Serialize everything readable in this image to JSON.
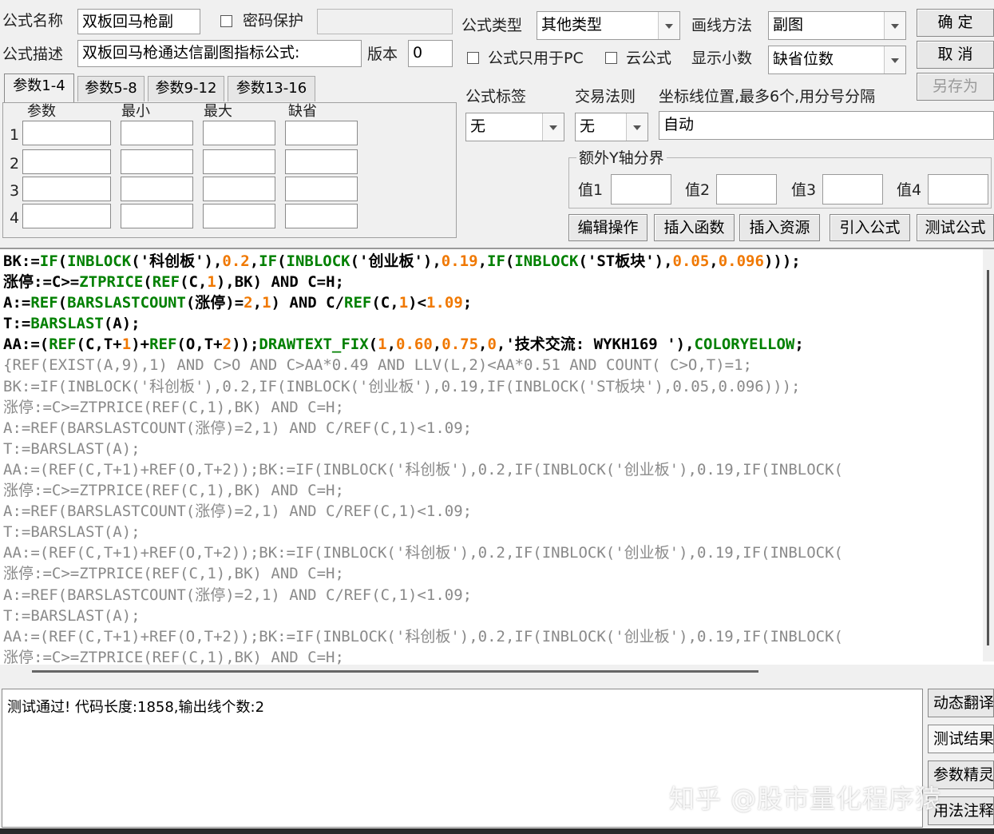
{
  "header": {
    "name_label": "公式名称",
    "name_value": "双板回马枪副",
    "password_label": "密码保护",
    "desc_label": "公式描述",
    "desc_value": "双板回马枪通达信副图指标公式:",
    "version_label": "版本",
    "version_value": "0",
    "type_label": "公式类型",
    "type_value": "其他类型",
    "draw_label": "画线方法",
    "draw_value": "副图",
    "pc_only_label": "公式只用于PC",
    "cloud_label": "云公式",
    "decimals_label": "显示小数",
    "decimals_value": "缺省位数"
  },
  "buttons": {
    "ok": "确  定",
    "cancel": "取  消",
    "save_as": "另存为",
    "edit_ops": "编辑操作",
    "insert_func": "插入函数",
    "insert_res": "插入资源",
    "import_formula": "引入公式",
    "test_formula": "测试公式"
  },
  "tabs": [
    "参数1-4",
    "参数5-8",
    "参数9-12",
    "参数13-16"
  ],
  "params": {
    "headers": [
      "参数",
      "最小",
      "最大",
      "缺省"
    ],
    "rows": [
      "1",
      "2",
      "3",
      "4"
    ]
  },
  "options": {
    "tag_label": "公式标签",
    "tag_value": "无",
    "rule_label": "交易法则",
    "rule_value": "无",
    "axis_label": "坐标线位置,最多6个,用分号分隔",
    "axis_value": "自动",
    "yaxis_group": "额外Y轴分界",
    "y1": "值1",
    "y2": "值2",
    "y3": "值3",
    "y4": "值4"
  },
  "code_lines": [
    {
      "segs": [
        [
          "BK:=",
          "#000"
        ],
        [
          "IF",
          "#008000"
        ],
        [
          "(",
          "#000"
        ],
        [
          "INBLOCK",
          "#008000"
        ],
        [
          "('科创板'),",
          "#000"
        ],
        [
          "0.2",
          "#f07800"
        ],
        [
          ",",
          "#000"
        ],
        [
          "IF",
          "#008000"
        ],
        [
          "(",
          "#000"
        ],
        [
          "INBLOCK",
          "#008000"
        ],
        [
          "('创业板'),",
          "#000"
        ],
        [
          "0.19",
          "#f07800"
        ],
        [
          ",",
          "#000"
        ],
        [
          "IF",
          "#008000"
        ],
        [
          "(",
          "#000"
        ],
        [
          "INBLOCK",
          "#008000"
        ],
        [
          "('ST板块'),",
          "#000"
        ],
        [
          "0.05",
          "#f07800"
        ],
        [
          ",",
          "#000"
        ],
        [
          "0.096",
          "#f07800"
        ],
        [
          ")));",
          "#000"
        ]
      ]
    },
    {
      "segs": [
        [
          "涨停:=C>=",
          "#000"
        ],
        [
          "ZTPRICE",
          "#008000"
        ],
        [
          "(",
          "#000"
        ],
        [
          "REF",
          "#008000"
        ],
        [
          "(C,",
          "#000"
        ],
        [
          "1",
          "#f07800"
        ],
        [
          "),BK) AND C=H;",
          "#000"
        ]
      ]
    },
    {
      "segs": [
        [
          "A:=",
          "#000"
        ],
        [
          "REF",
          "#008000"
        ],
        [
          "(",
          "#000"
        ],
        [
          "BARSLASTCOUNT",
          "#008000"
        ],
        [
          "(涨停)=",
          "#000"
        ],
        [
          "2",
          "#f07800"
        ],
        [
          ",",
          "#000"
        ],
        [
          "1",
          "#f07800"
        ],
        [
          ") AND C/",
          "#000"
        ],
        [
          "REF",
          "#008000"
        ],
        [
          "(C,",
          "#000"
        ],
        [
          "1",
          "#f07800"
        ],
        [
          ")<",
          "#000"
        ],
        [
          "1.09",
          "#f07800"
        ],
        [
          ";",
          "#000"
        ]
      ]
    },
    {
      "segs": [
        [
          "T:=",
          "#000"
        ],
        [
          "BARSLAST",
          "#008000"
        ],
        [
          "(A);",
          "#000"
        ]
      ]
    },
    {
      "segs": [
        [
          "AA:=(",
          "#000"
        ],
        [
          "REF",
          "#008000"
        ],
        [
          "(C,T+",
          "#000"
        ],
        [
          "1",
          "#f07800"
        ],
        [
          ")+",
          "#000"
        ],
        [
          "REF",
          "#008000"
        ],
        [
          "(O,T+",
          "#000"
        ],
        [
          "2",
          "#f07800"
        ],
        [
          "));",
          "#000"
        ],
        [
          "DRAWTEXT_FIX",
          "#008000"
        ],
        [
          "(",
          "#000"
        ],
        [
          "1",
          "#f07800"
        ],
        [
          ",",
          "#000"
        ],
        [
          "0.60",
          "#f07800"
        ],
        [
          ",",
          "#000"
        ],
        [
          "0.75",
          "#f07800"
        ],
        [
          ",",
          "#000"
        ],
        [
          "0",
          "#f07800"
        ],
        [
          ",'技术交流: WYKH169 '),",
          "#000"
        ],
        [
          "COLORYELLOW",
          "#008000"
        ],
        [
          ";",
          "#000"
        ]
      ]
    },
    {
      "dim": "{REF(EXIST(A,9),1) AND C>O AND C>AA*0.49 AND LLV(L,2)<AA*0.51 AND COUNT( C>O,T)=1;"
    },
    {
      "dim": "BK:=IF(INBLOCK('科创板'),0.2,IF(INBLOCK('创业板'),0.19,IF(INBLOCK('ST板块'),0.05,0.096)));"
    },
    {
      "dim": "涨停:=C>=ZTPRICE(REF(C,1),BK) AND C=H;"
    },
    {
      "dim": "A:=REF(BARSLASTCOUNT(涨停)=2,1) AND C/REF(C,1)<1.09;"
    },
    {
      "dim": "T:=BARSLAST(A);"
    },
    {
      "dim": "AA:=(REF(C,T+1)+REF(O,T+2));BK:=IF(INBLOCK('科创板'),0.2,IF(INBLOCK('创业板'),0.19,IF(INBLOCK("
    },
    {
      "dim": "涨停:=C>=ZTPRICE(REF(C,1),BK) AND C=H;"
    },
    {
      "dim": "A:=REF(BARSLASTCOUNT(涨停)=2,1) AND C/REF(C,1)<1.09;"
    },
    {
      "dim": "T:=BARSLAST(A);"
    },
    {
      "dim": "AA:=(REF(C,T+1)+REF(O,T+2));BK:=IF(INBLOCK('科创板'),0.2,IF(INBLOCK('创业板'),0.19,IF(INBLOCK("
    },
    {
      "dim": "涨停:=C>=ZTPRICE(REF(C,1),BK) AND C=H;"
    },
    {
      "dim": "A:=REF(BARSLASTCOUNT(涨停)=2,1) AND C/REF(C,1)<1.09;"
    },
    {
      "dim": "T:=BARSLAST(A);"
    },
    {
      "dim": "AA:=(REF(C,T+1)+REF(O,T+2));BK:=IF(INBLOCK('科创板'),0.2,IF(INBLOCK('创业板'),0.19,IF(INBLOCK("
    },
    {
      "dim": "涨停:=C>=ZTPRICE(REF(C,1),BK) AND C=H;"
    }
  ],
  "result": {
    "text": "测试通过! 代码长度:1858,输出线个数:2"
  },
  "side_buttons": [
    "动态翻译",
    "测试结果",
    "参数精灵",
    "用法注释"
  ],
  "watermark": "知乎 @股市量化程序猿"
}
